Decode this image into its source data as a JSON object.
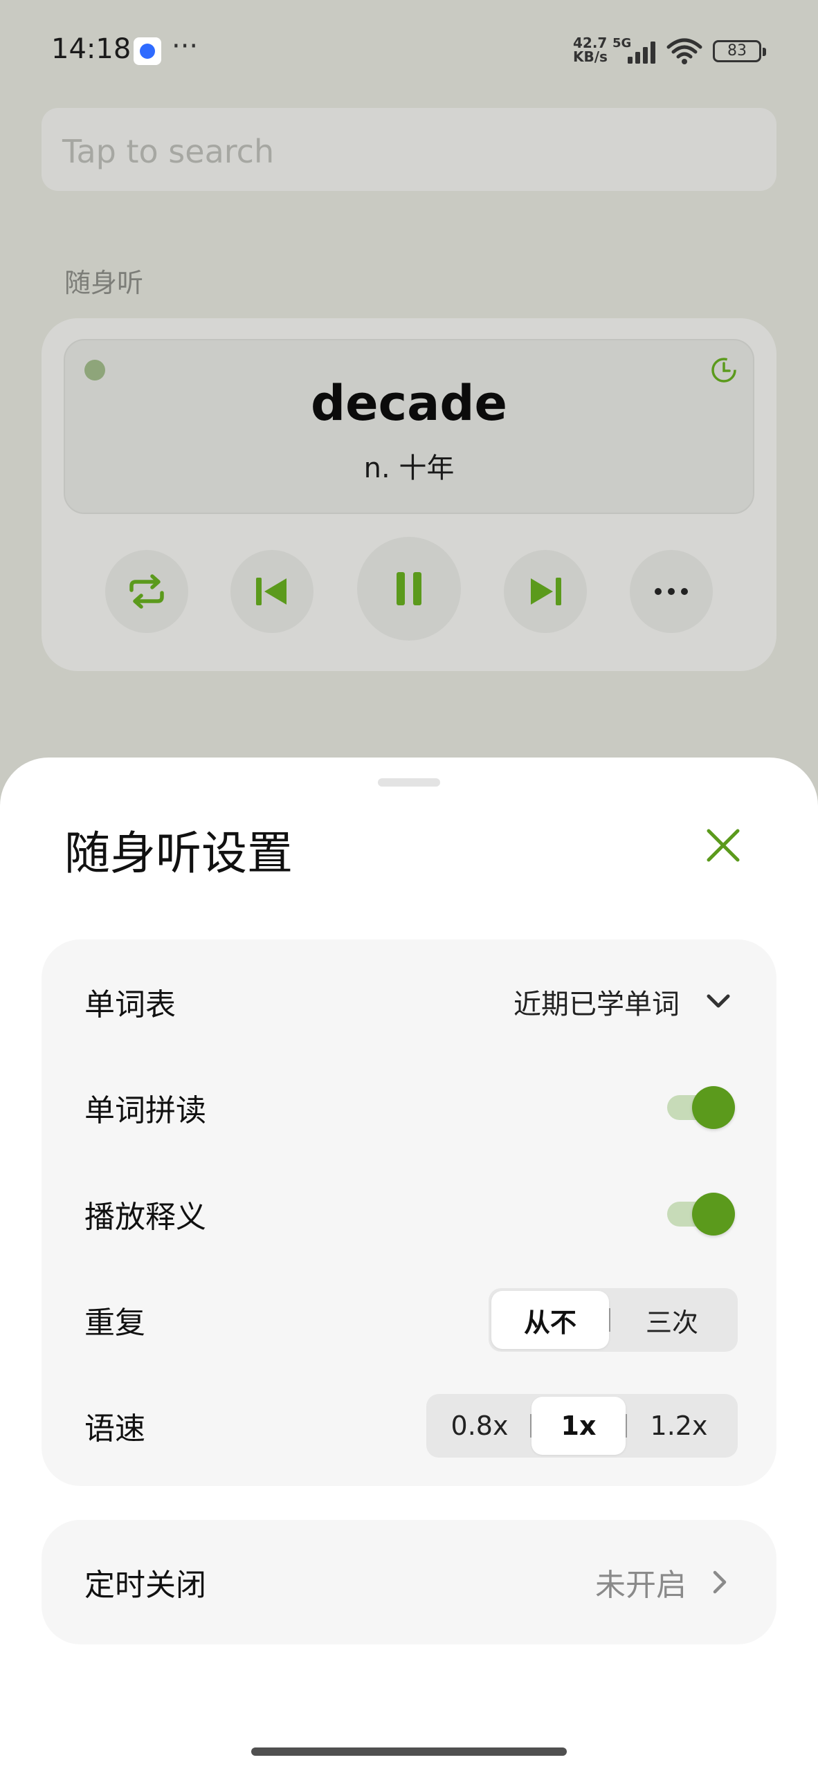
{
  "status_bar": {
    "time": "14:18",
    "dots": "···",
    "net_speed_top": "42.7",
    "net_speed_bottom": "KB/s",
    "network_type": "5G",
    "battery": "83"
  },
  "search": {
    "placeholder": "Tap to search"
  },
  "section": {
    "label": "随身听"
  },
  "player": {
    "word": "decade",
    "meaning": "n. 十年",
    "accent_color": "#5b9a1c",
    "controls": [
      "repeat-icon",
      "previous-icon",
      "pause-icon",
      "next-icon",
      "more-icon"
    ]
  },
  "sheet": {
    "title": "随身听设置",
    "settings": {
      "wordlist_label": "单词表",
      "wordlist_value": "近期已学单词",
      "spelling_label": "单词拼读",
      "spelling_on": true,
      "definition_label": "播放释义",
      "definition_on": true,
      "repeat_label": "重复",
      "repeat_options": [
        "从不",
        "三次"
      ],
      "repeat_selected": "从不",
      "speed_label": "语速",
      "speed_options": [
        "0.8x",
        "1x",
        "1.2x"
      ],
      "speed_selected": "1x"
    },
    "timer": {
      "label": "定时关闭",
      "value": "未开启"
    }
  }
}
